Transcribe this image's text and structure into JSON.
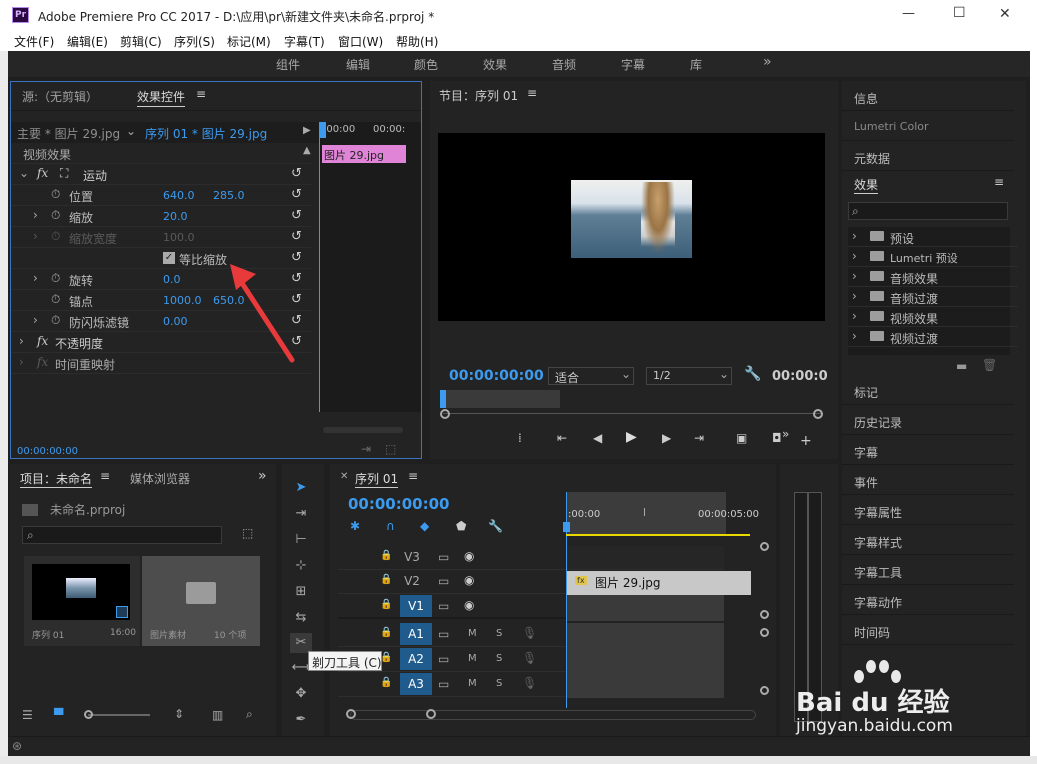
{
  "titlebar": {
    "logo": "Pr",
    "title": "Adobe Premiere Pro CC 2017 - D:\\应用\\pr\\新建文件夹\\未命名.prproj *",
    "minimize": "—",
    "maximize": "☐",
    "close": "✕"
  },
  "menu": [
    "文件(F)",
    "编辑(E)",
    "剪辑(C)",
    "序列(S)",
    "标记(M)",
    "字幕(T)",
    "窗口(W)",
    "帮助(H)"
  ],
  "workspaces": [
    "组件",
    "编辑",
    "颜色",
    "效果",
    "音频",
    "字幕",
    "库"
  ],
  "workspace_more": "»",
  "source_panel": {
    "tab_source": "源:（无剪辑）",
    "tab_effect_controls": "效果控件",
    "master_label": "主要 * 图片 29.jpg",
    "sequence_label": "序列 01 * 图片 29.jpg",
    "tc_start": ":00:00",
    "tc_end": "00:00:",
    "clip_name": "图片 29.jpg",
    "video_effects": "视频效果",
    "motion": "运动",
    "position_label": "位置",
    "position_x": "640.0",
    "position_y": "285.0",
    "scale_label": "缩放",
    "scale_value": "20.0",
    "scale_width_label": "缩放宽度",
    "scale_width_value": "100.0",
    "uniform_scale_label": "等比缩放",
    "rotation_label": "旋转",
    "rotation_value": "0.0",
    "anchor_label": "锚点",
    "anchor_x": "1000.0",
    "anchor_y": "650.0",
    "flicker_label": "防闪烁滤镜",
    "flicker_value": "0.00",
    "opacity_label": "不透明度",
    "time_remap_label": "时间重映射",
    "timecode": "00:00:00:00"
  },
  "program_panel": {
    "title": "节目：序列 01",
    "timecode": "00:00:00:00",
    "fit": "适合",
    "resolution": "1/2",
    "timecode_right": "00:00:0"
  },
  "project_panel": {
    "tab_project": "项目：未命名",
    "tab_media": "媒体浏览器",
    "project_file": "未命名.prproj",
    "item1_name": "序列 01",
    "item1_duration": "16:00",
    "item2_name": "图片素材",
    "item2_count": "10 个项"
  },
  "tools": {
    "tooltip": "剃刀工具 (C)"
  },
  "timeline": {
    "title": "序列 01",
    "timecode": "00:00:00:00",
    "ruler_start": ":00:00",
    "ruler_end": "00:00:05:00",
    "tracks": [
      "V3",
      "V2",
      "V1",
      "A1",
      "A2",
      "A3"
    ],
    "clip_name": "图片 29.jpg",
    "m": "M",
    "s": "S"
  },
  "right_panel": {
    "info": "信息",
    "lumetri_color": "Lumetri Color",
    "metadata": "元数据",
    "effects": "效果",
    "effects_items": [
      "预设",
      "Lumetri 预设",
      "音频效果",
      "音频过渡",
      "视频效果",
      "视频过渡"
    ],
    "lower_items": [
      "标记",
      "历史记录",
      "字幕",
      "事件",
      "字幕属性",
      "字幕样式",
      "字幕工具",
      "字幕动作",
      "时间码"
    ]
  },
  "watermark": {
    "brand": "Bai du 经验",
    "url": "jingyan.baidu.com"
  },
  "colors": {
    "accent_blue": "#3c9bef",
    "clip_pink": "#e084d8",
    "track_blue": "#1f5b8c",
    "playhead": "#3c9bef",
    "yellow_bar": "#e8d800"
  }
}
